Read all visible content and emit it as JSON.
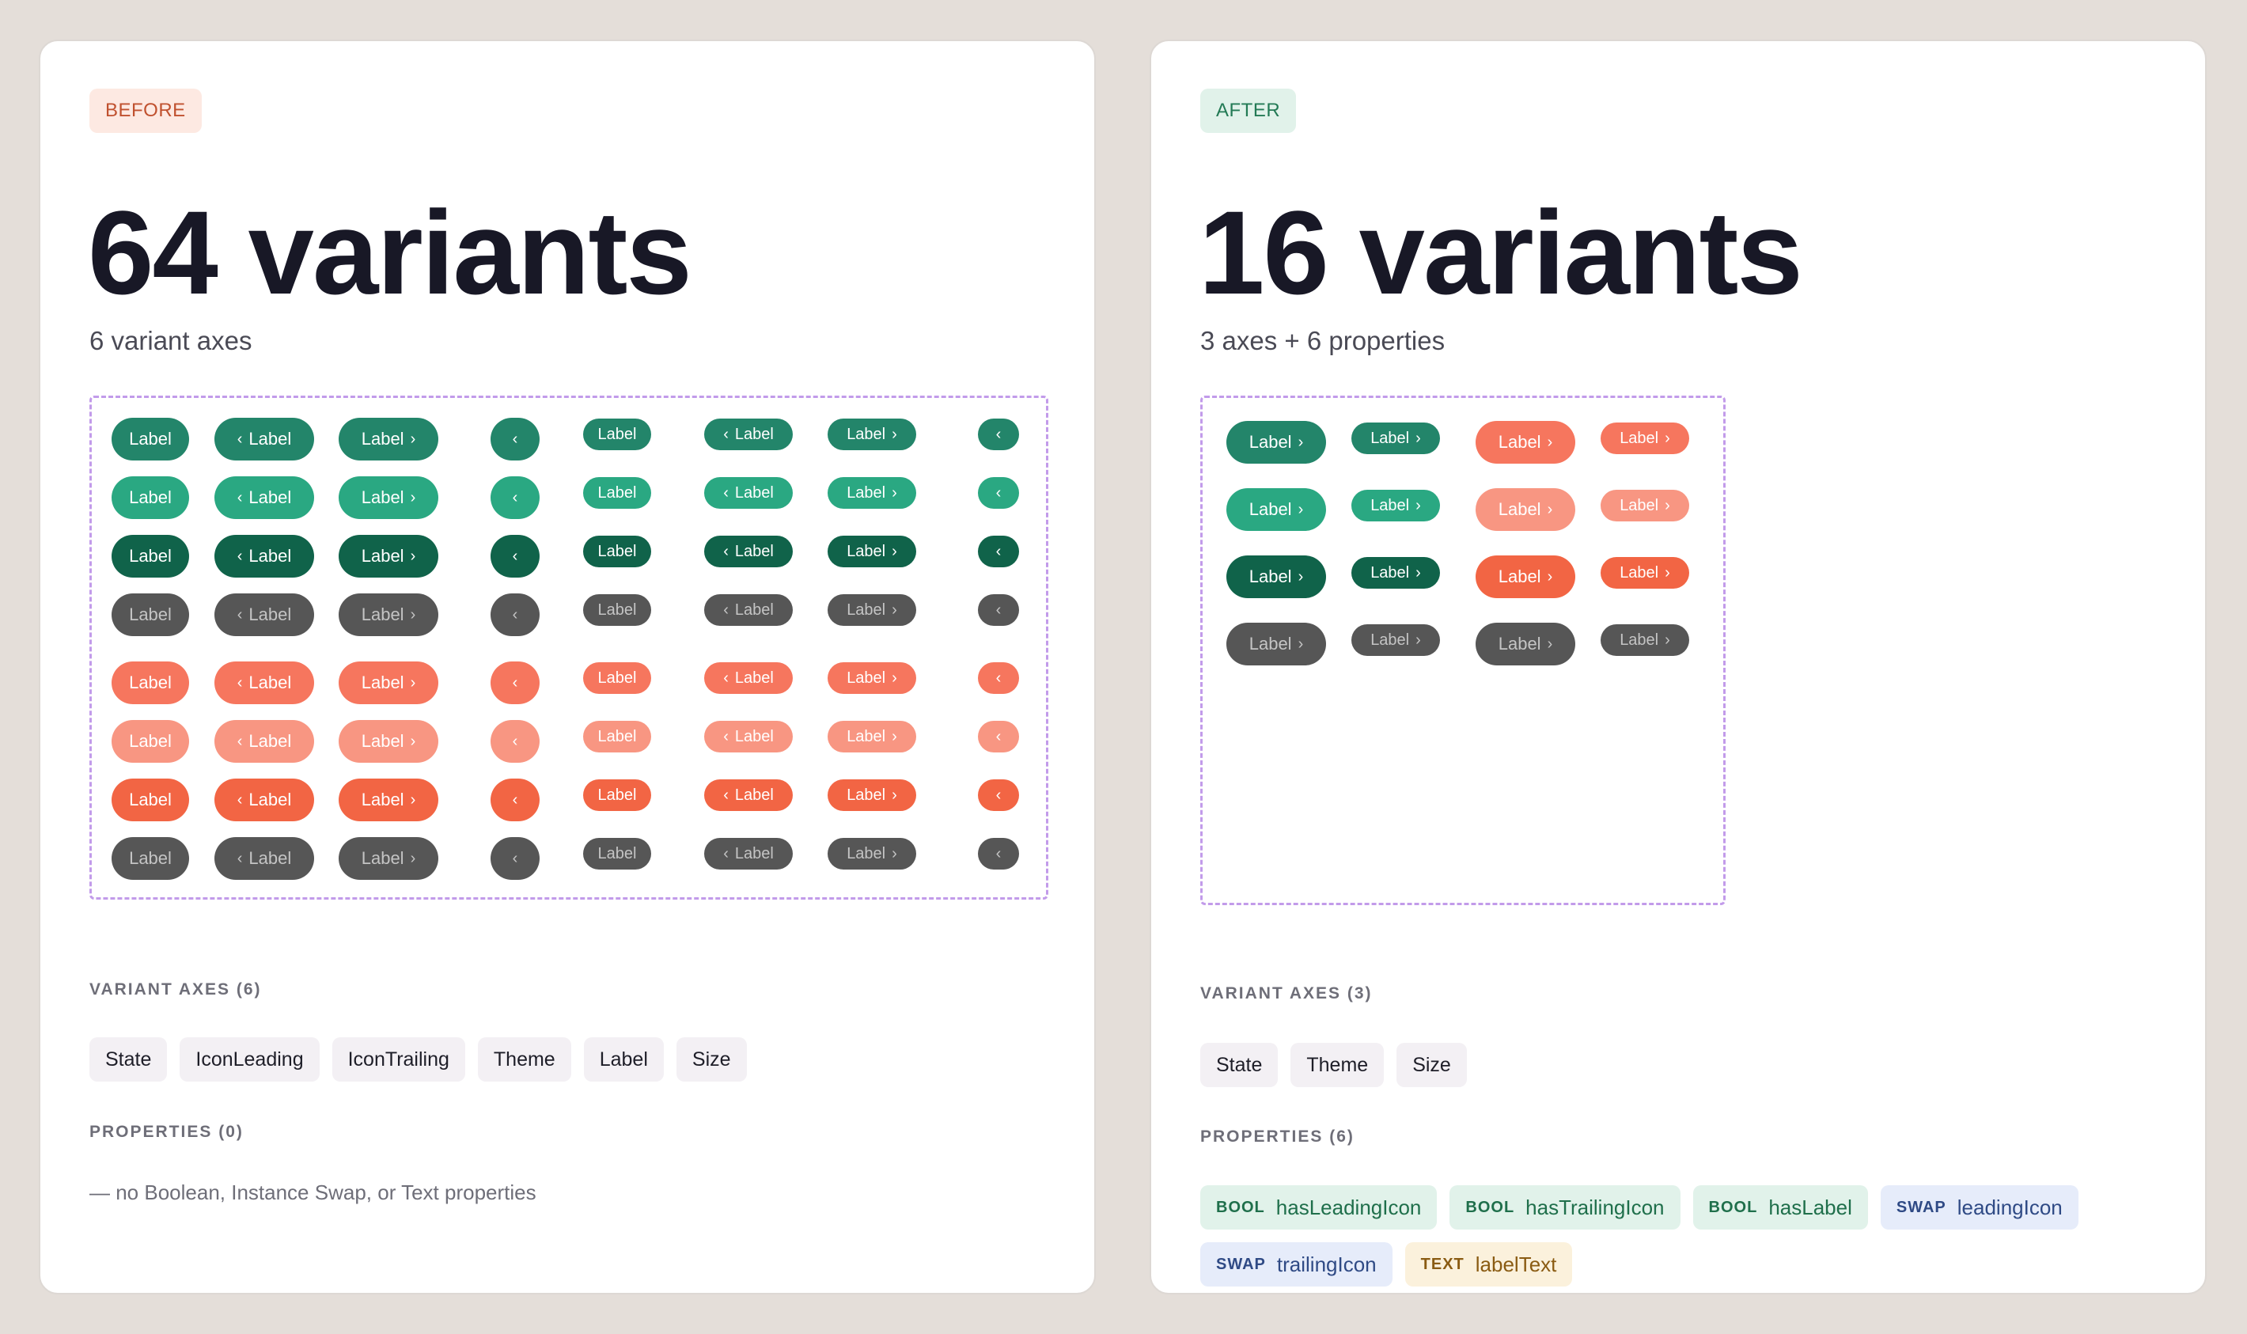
{
  "colors": {
    "background": "#e4ded9",
    "green_default": "#23856a",
    "green_hover": "#2aa882",
    "green_pressed": "#10634a",
    "coral_default": "#f6765e",
    "coral_hover": "#f89682",
    "coral_pressed": "#f26544",
    "disabled": "#565656",
    "dashed_border": "#c29bea"
  },
  "before": {
    "tag": "BEFORE",
    "title": "64 variants",
    "subtitle": "6 variant axes",
    "button_label": "Label",
    "axes_heading": "VARIANT AXES (6)",
    "axes": [
      "State",
      "IconLeading",
      "IconTrailing",
      "Theme",
      "Label",
      "Size"
    ],
    "properties_heading": "PROPERTIES (0)",
    "properties_note": "— no Boolean, Instance Swap, or Text properties",
    "grid": {
      "themes": [
        "green",
        "coral"
      ],
      "states": [
        "default",
        "hover",
        "pressed",
        "disabled"
      ],
      "sizes": [
        "md",
        "sm"
      ],
      "icon_configs": [
        "label-only",
        "leading-icon",
        "trailing-icon",
        "icon-only"
      ]
    }
  },
  "after": {
    "tag": "AFTER",
    "title": "16 variants",
    "subtitle": "3 axes + 6 properties",
    "button_label": "Label",
    "axes_heading": "VARIANT AXES (3)",
    "axes": [
      "State",
      "Theme",
      "Size"
    ],
    "properties_heading": "PROPERTIES (6)",
    "properties": [
      {
        "kind": "BOOL",
        "name": "hasLeadingIcon"
      },
      {
        "kind": "BOOL",
        "name": "hasTrailingIcon"
      },
      {
        "kind": "BOOL",
        "name": "hasLabel"
      },
      {
        "kind": "SWAP",
        "name": "leadingIcon"
      },
      {
        "kind": "SWAP",
        "name": "trailingIcon"
      },
      {
        "kind": "TEXT",
        "name": "labelText"
      }
    ]
  },
  "icons": {
    "leading": "chevron-left-icon",
    "trailing": "chevron-right-icon",
    "leading_glyph": "‹",
    "trailing_glyph": "›"
  }
}
